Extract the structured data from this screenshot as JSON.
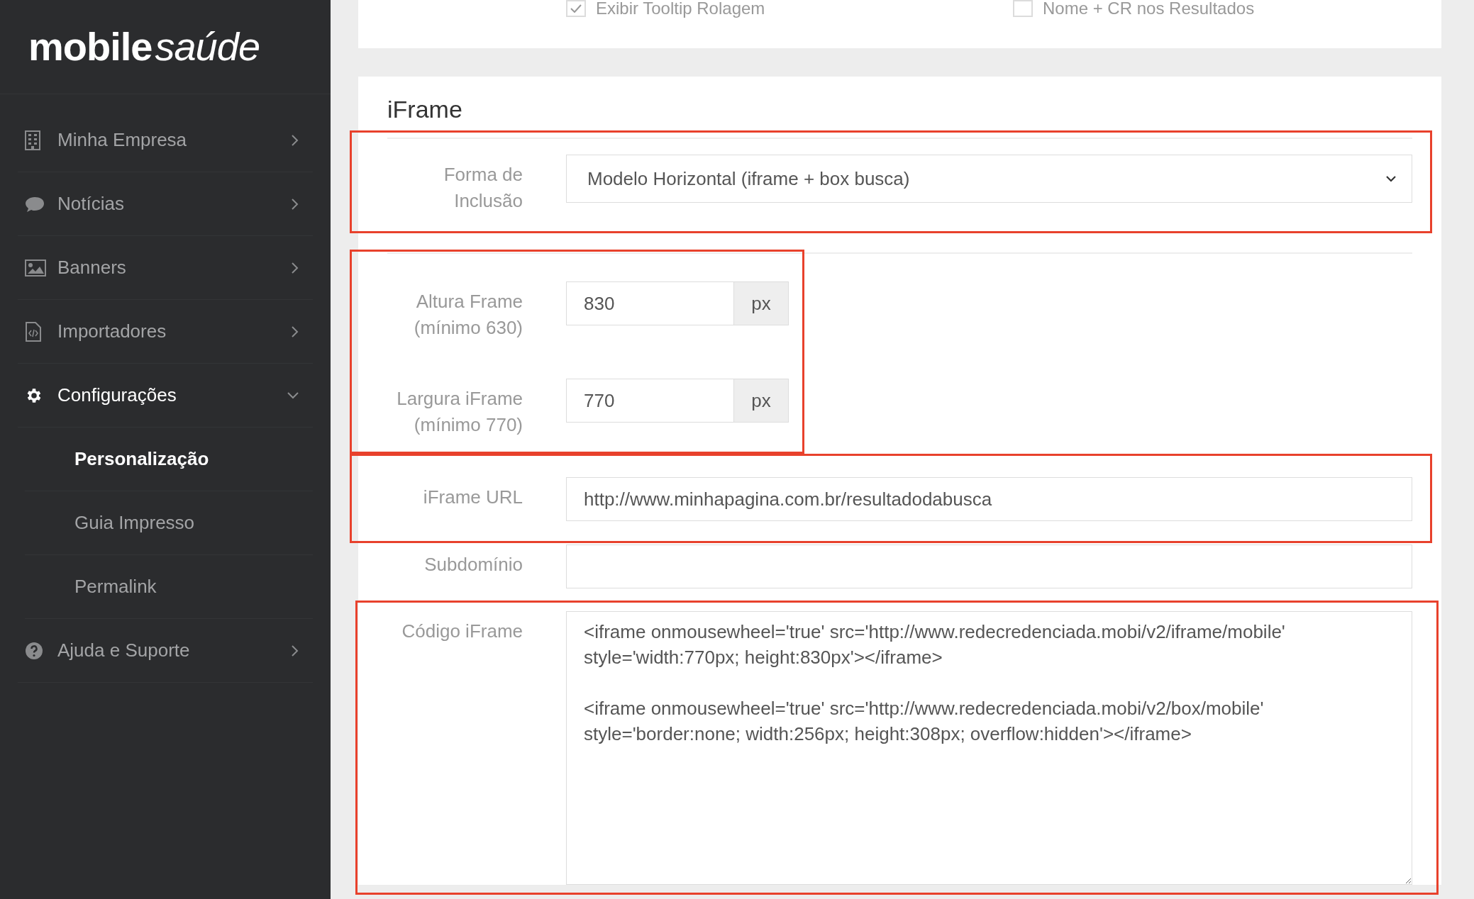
{
  "sidebar": {
    "logo": {
      "bold": "mobile",
      "light": "saúde"
    },
    "items": [
      {
        "label": "Minha Empresa",
        "selected": false,
        "expanded": false
      },
      {
        "label": "Notícias",
        "selected": false,
        "expanded": false
      },
      {
        "label": "Banners",
        "selected": false,
        "expanded": false
      },
      {
        "label": "Importadores",
        "selected": false,
        "expanded": false
      },
      {
        "label": "Configurações",
        "selected": true,
        "expanded": true,
        "children": [
          {
            "label": "Personalização",
            "selected": true
          },
          {
            "label": "Guia Impresso",
            "selected": false
          },
          {
            "label": "Permalink",
            "selected": false
          }
        ]
      },
      {
        "label": "Ajuda e Suporte",
        "selected": false,
        "expanded": false
      }
    ]
  },
  "options_card": {
    "checkboxes": [
      {
        "label": "Exibir Tooltip Rolagem",
        "checked": true
      },
      {
        "label": "Nome + CR nos Resultados",
        "checked": false
      }
    ]
  },
  "iframe_card": {
    "title": "iFrame",
    "groups": [
      {
        "highlighted": true,
        "divider_before": true,
        "fields": [
          {
            "kind": "select",
            "label": "Forma de Inclusão",
            "value": "Modelo Horizontal (iframe + box busca)"
          }
        ]
      },
      {
        "highlighted": true,
        "divider_before": true,
        "fields": [
          {
            "kind": "addon",
            "label": "Altura Frame (mínimo 630)",
            "value": "830",
            "addon": "px"
          },
          {
            "kind": "addon",
            "label": "Largura iFrame (mínimo 770)",
            "value": "770",
            "addon": "px"
          }
        ]
      },
      {
        "highlighted": true,
        "divider_before": false,
        "fields": [
          {
            "kind": "text",
            "label": "iFrame URL",
            "value": "http://www.minhapagina.com.br/resultadodabusca"
          }
        ]
      },
      {
        "highlighted": false,
        "divider_before": false,
        "fields": [
          {
            "kind": "text",
            "label": "Subdomínio"
          }
        ]
      },
      {
        "highlighted": true,
        "divider_before": false,
        "fields": [
          {
            "kind": "textarea",
            "label": "Código iFrame",
            "value": "<iframe onmousewheel='true' src='http://www.redecredenciada.mobi/v2/iframe/mobile' style='width:770px; height:830px'></iframe>\n\n<iframe onmousewheel='true' src='http://www.redecredenciada.mobi/v2/box/mobile' style='border:none; width:256px; height:308px; overflow:hidden'></iframe>"
          }
        ]
      }
    ]
  }
}
